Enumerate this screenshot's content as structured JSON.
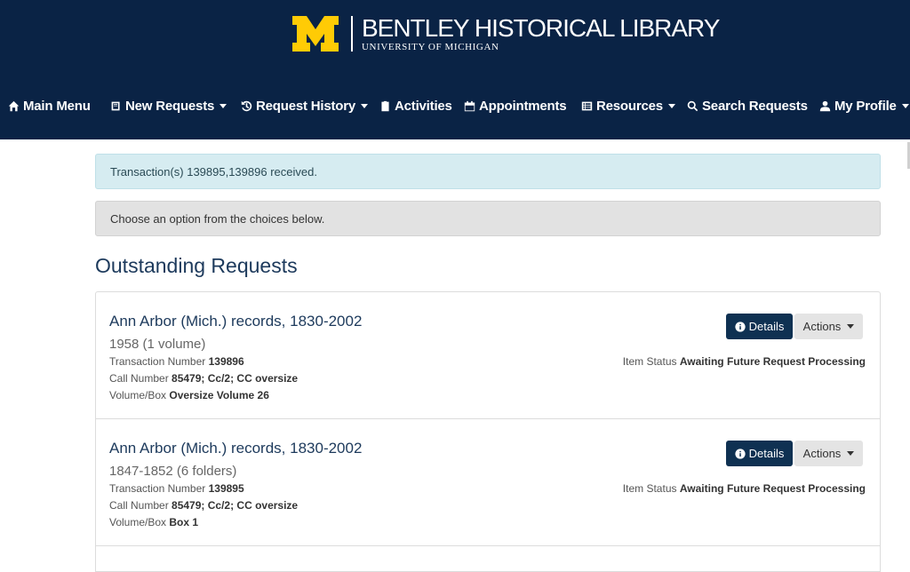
{
  "brand": {
    "title": "BENTLEY HISTORICAL LIBRARY",
    "subtitle": "UNIVERSITY OF MICHIGAN",
    "logo_letter": "M",
    "colors": {
      "header_bg": "#0a2345",
      "maize": "#ffcb05"
    }
  },
  "nav": {
    "items": [
      {
        "label": "Main Menu",
        "icon": "home-icon",
        "dropdown": false
      },
      {
        "label": "New Requests",
        "icon": "book-icon",
        "dropdown": true
      },
      {
        "label": "Request History",
        "icon": "history-icon",
        "dropdown": true
      },
      {
        "label": "Activities",
        "icon": "clipboard-icon",
        "dropdown": false
      },
      {
        "label": "Appointments",
        "icon": "calendar-icon",
        "dropdown": false
      },
      {
        "label": "Resources",
        "icon": "list-icon",
        "dropdown": true
      },
      {
        "label": "Search Requests",
        "icon": "search-icon",
        "dropdown": false
      },
      {
        "label": "My Profile",
        "icon": "user-icon",
        "dropdown": true
      }
    ]
  },
  "alerts": {
    "info": "Transaction(s) 139895,139896 received.",
    "choose": "Choose an option from the choices below."
  },
  "section_title": "Outstanding Requests",
  "labels": {
    "transaction_number": "Transaction Number",
    "call_number": "Call Number",
    "volume_box": "Volume/Box",
    "item_status": "Item Status",
    "details_button": "Details",
    "actions_button": "Actions"
  },
  "requests": [
    {
      "title": "Ann Arbor (Mich.) records, 1830-2002",
      "subtitle": "1958 (1 volume)",
      "transaction_number": "139896",
      "call_number": "85479; Cc/2; CC oversize",
      "volume_box": "Oversize Volume 26",
      "item_status": "Awaiting Future Request Processing"
    },
    {
      "title": "Ann Arbor (Mich.) records, 1830-2002",
      "subtitle": "1847-1852 (6 folders)",
      "transaction_number": "139895",
      "call_number": "85479; Cc/2; CC oversize",
      "volume_box": "Box 1",
      "item_status": "Awaiting Future Request Processing"
    }
  ]
}
